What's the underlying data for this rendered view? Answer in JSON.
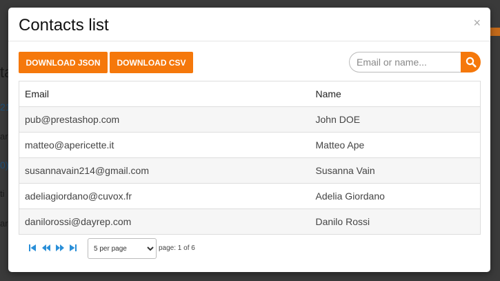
{
  "background": {
    "fragments": [
      "ta",
      "21",
      "ar",
      "0)",
      "ti",
      "ar"
    ]
  },
  "modal": {
    "title": "Contacts list",
    "close_label": "×"
  },
  "toolbar": {
    "download_json_label": "DOWNLOAD JSON",
    "download_csv_label": "DOWNLOAD CSV",
    "search_placeholder": "Email or name...",
    "accent_color": "#f5780b"
  },
  "table": {
    "columns": [
      "Email",
      "Name"
    ],
    "rows": [
      {
        "email": "pub@prestashop.com",
        "name": "John DOE"
      },
      {
        "email": "matteo@apericette.it",
        "name": "Matteo Ape"
      },
      {
        "email": "susannavain214@gmail.com",
        "name": "Susanna Vain"
      },
      {
        "email": "adeliagiordano@cuvox.fr",
        "name": "Adelia Giordano"
      },
      {
        "email": "danilorossi@dayrep.com",
        "name": "Danilo Rossi"
      }
    ]
  },
  "pagination": {
    "per_page_selected": "5 per page",
    "page_info": "page: 1 of 6",
    "icons": [
      "first-page-icon",
      "previous-page-icon",
      "next-page-icon",
      "last-page-icon"
    ],
    "icon_color": "#2a8fd8"
  }
}
